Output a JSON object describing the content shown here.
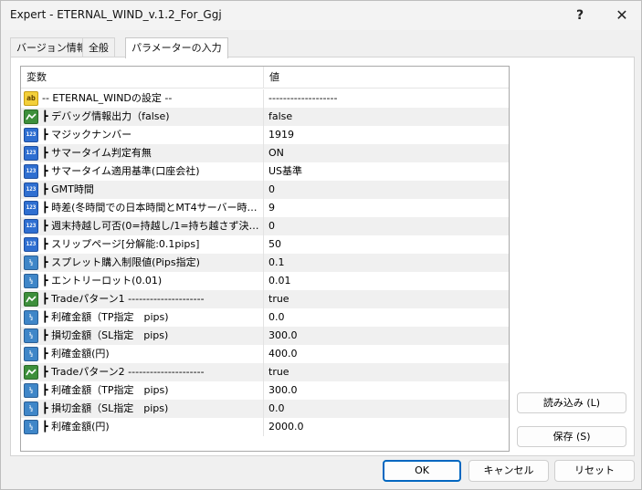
{
  "window": {
    "title": "Expert - ETERNAL_WIND_v.1.2_For_Ggj",
    "help_glyph": "?",
    "close_glyph": "✕"
  },
  "tabs": [
    {
      "label": "バージョン情報"
    },
    {
      "label": "全般"
    },
    {
      "label": "パラメーターの入力",
      "active": true
    }
  ],
  "grid": {
    "columns": {
      "name": "変数",
      "value": "値"
    },
    "rows": [
      {
        "icon": "ab",
        "name": "-- ETERNAL_WINDの設定 --",
        "value": "-------------------"
      },
      {
        "icon": "bool",
        "name": "┣ デバッグ情報出力（false)",
        "value": "false"
      },
      {
        "icon": "num",
        "name": "┣ マジックナンバー",
        "value": "1919"
      },
      {
        "icon": "num",
        "name": "┣ サマータイム判定有無",
        "value": "ON"
      },
      {
        "icon": "num",
        "name": "┣ サマータイム適用基準(口座会社)",
        "value": "US基準"
      },
      {
        "icon": "num",
        "name": "┣ GMT時間",
        "value": "0"
      },
      {
        "icon": "num",
        "name": "┣ 時差(冬時間での日本時間とMT4サーバー時…",
        "value": "9"
      },
      {
        "icon": "num",
        "name": "┣ 週末持越し可否(0=持越し/1=持ち越さず決…",
        "value": "0"
      },
      {
        "icon": "num",
        "name": "┣ スリップページ[分解能:0.1pips]",
        "value": "50"
      },
      {
        "icon": "dbl",
        "name": "┣ スプレット購入制限値(Pips指定)",
        "value": "0.1"
      },
      {
        "icon": "dbl",
        "name": "┣ エントリーロット(0.01)",
        "value": "0.01"
      },
      {
        "icon": "bool",
        "name": "┣ Tradeパターン1 ---------------------",
        "value": "true"
      },
      {
        "icon": "dbl",
        "name": "┣ 利確金額（TP指定　pips)",
        "value": "0.0"
      },
      {
        "icon": "dbl",
        "name": "┣ 損切金額（SL指定　pips)",
        "value": "300.0"
      },
      {
        "icon": "dbl",
        "name": "┣ 利確金額(円)",
        "value": "400.0"
      },
      {
        "icon": "bool",
        "name": "┣ Tradeパターン2 ---------------------",
        "value": "true"
      },
      {
        "icon": "dbl",
        "name": "┣ 利確金額（TP指定　pips)",
        "value": "300.0"
      },
      {
        "icon": "dbl",
        "name": "┣ 損切金額（SL指定　pips)",
        "value": "0.0"
      },
      {
        "icon": "dbl",
        "name": "┣ 利確金額(円)",
        "value": "2000.0"
      }
    ]
  },
  "icon_labels": {
    "ab": "ab",
    "num": "123",
    "dbl": "½"
  },
  "side_buttons": {
    "load": "読み込み (L)",
    "save": "保存 (S)"
  },
  "footer": {
    "ok": "OK",
    "cancel": "キャンセル",
    "reset": "リセット"
  }
}
